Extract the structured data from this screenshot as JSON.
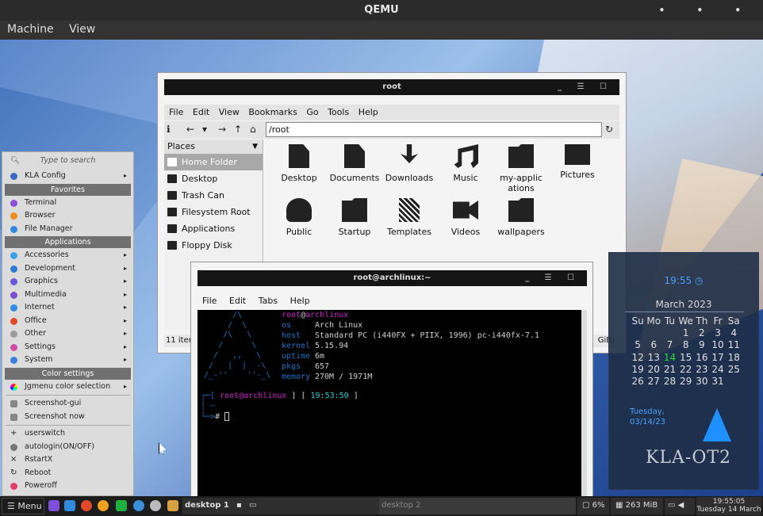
{
  "qemu": {
    "title": "QEMU",
    "menu": [
      "Machine",
      "View"
    ]
  },
  "file_manager": {
    "title": "root",
    "menu": [
      "File",
      "Edit",
      "View",
      "Bookmarks",
      "Go",
      "Tools",
      "Help"
    ],
    "path": "/root",
    "places_header": "Places",
    "places": [
      "Home Folder",
      "Desktop",
      "Trash Can",
      "Filesystem Root",
      "Applications",
      "Floppy Disk"
    ],
    "files": [
      "Desktop",
      "Documents",
      "Downloads",
      "Music",
      "my-applications",
      "Pictures",
      "Public",
      "Startup",
      "Templates",
      "Videos",
      "wallpapers"
    ],
    "status_left": "11 item",
    "status_right": "GiB)"
  },
  "terminal": {
    "title": "root@archlinux:~",
    "menu": [
      "File",
      "Edit",
      "Tabs",
      "Help"
    ],
    "user": "root",
    "at": "@",
    "host": "archlinux",
    "info": [
      {
        "key": "os",
        "value": "Arch Linux"
      },
      {
        "key": "host",
        "value": "Standard PC (i440FX + PIIX, 1996) pc-i440fx-7.1"
      },
      {
        "key": "kernel",
        "value": "5.15.94"
      },
      {
        "key": "uptime",
        "value": "6m"
      },
      {
        "key": "pkgs",
        "value": "657"
      },
      {
        "key": "memory",
        "value": "270M / 1971M"
      }
    ],
    "prompt_time": "19:53:50",
    "prompt_dir": "~",
    "prompt_symbol": "#"
  },
  "menu": {
    "search_placeholder": "Type to search",
    "top": "KLA Config",
    "favorites_header": "Favorites",
    "favorites": [
      "Terminal",
      "Browser",
      "File Manager"
    ],
    "apps_header": "Applications",
    "apps": [
      "Accessories",
      "Development",
      "Graphics",
      "Multimedia",
      "Internet",
      "Office",
      "Other",
      "Settings",
      "System"
    ],
    "color_header": "Color settings",
    "color_item": "Jgmenu color selection",
    "tools": [
      "Screenshot-gui",
      "Screenshot now"
    ],
    "session": [
      "userswitch",
      "autologin(ON/OFF)",
      "RstartX",
      "Reboot",
      "Poweroff"
    ]
  },
  "clock_widget": {
    "time": "19:55",
    "month": "March 2023",
    "weekdays": [
      "Su",
      "Mo",
      "Tu",
      "We",
      "Th",
      "Fr",
      "Sa"
    ],
    "weeks": [
      [
        "",
        "",
        "",
        "1",
        "2",
        "3",
        "4"
      ],
      [
        "5",
        "6",
        "7",
        "8",
        "9",
        "10",
        "11"
      ],
      [
        "12",
        "13",
        "14",
        "15",
        "16",
        "17",
        "18"
      ],
      [
        "19",
        "20",
        "21",
        "22",
        "23",
        "24",
        "25"
      ],
      [
        "26",
        "27",
        "28",
        "29",
        "30",
        "31",
        ""
      ]
    ],
    "today": "14",
    "date_line1": "Tuesday,",
    "date_line2": "03/14/23",
    "brand": "KLA-OT2"
  },
  "taskbar": {
    "menu_label": "Menu",
    "workspace1": "desktop 1",
    "workspace2": "desktop 2",
    "cpu": "6%",
    "mem": "263 MiB",
    "time": "19:55:05",
    "date": "Tuesday 14 March"
  }
}
